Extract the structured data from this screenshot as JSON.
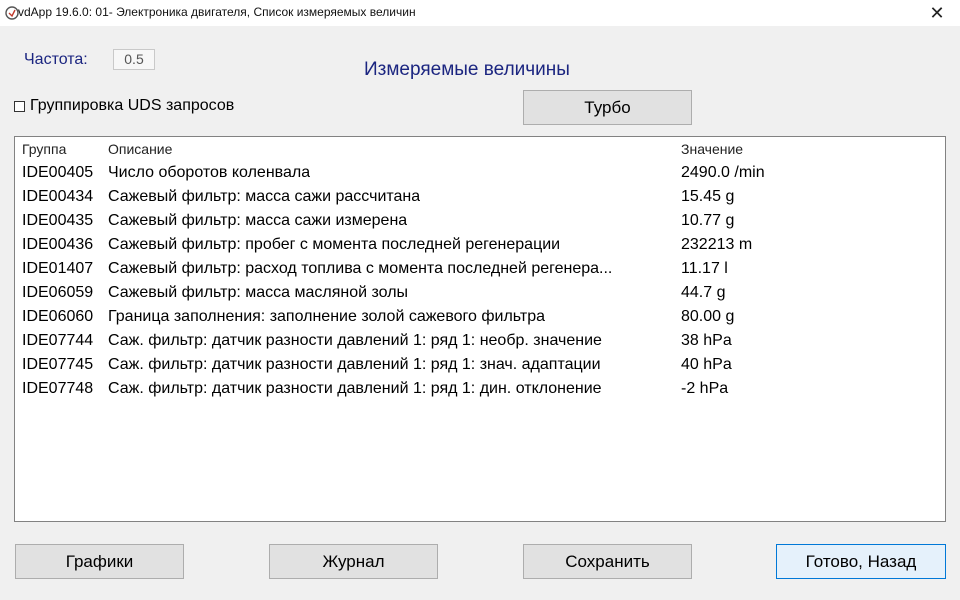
{
  "window": {
    "title": "vdApp 19.6.0: 01- Электроника двигателя,  Список измеряемых величин",
    "close_symbol": "✕"
  },
  "frequency": {
    "label": "Частота:",
    "value": "0.5"
  },
  "page_title": "Измеряемые величины",
  "uds_grouping": {
    "label": "Группировка UDS запросов",
    "checked": false
  },
  "turbo_button": "Турбо",
  "table": {
    "headers": {
      "group": "Группа",
      "description": "Описание",
      "value": "Значение"
    },
    "rows": [
      {
        "group": "IDE00405",
        "description": "Число оборотов коленвала",
        "value": "2490.0 /min"
      },
      {
        "group": "IDE00434",
        "description": "Сажевый фильтр: масса сажи рассчитана",
        "value": "15.45 g"
      },
      {
        "group": "IDE00435",
        "description": "Сажевый фильтр: масса сажи измерена",
        "value": "10.77 g"
      },
      {
        "group": "IDE00436",
        "description": "Сажевый фильтр: пробег с момента последней регенерации",
        "value": "232213 m"
      },
      {
        "group": "IDE01407",
        "description": "Сажевый фильтр: расход топлива с момента последней регенера...",
        "value": "11.17 l"
      },
      {
        "group": "IDE06059",
        "description": "Сажевый фильтр: масса масляной золы",
        "value": "44.7 g"
      },
      {
        "group": "IDE06060",
        "description": "Граница заполнения: заполнение золой сажевого фильтра",
        "value": "80.00 g"
      },
      {
        "group": "IDE07744",
        "description": "Саж. фильтр: датчик разности давлений 1: ряд 1: необр. значение",
        "value": "38 hPa"
      },
      {
        "group": "IDE07745",
        "description": "Саж. фильтр: датчик разности давлений 1: ряд 1: знач. адаптации",
        "value": "40 hPa"
      },
      {
        "group": "IDE07748",
        "description": "Саж. фильтр: датчик разности давлений 1: ряд 1: дин. отклонение",
        "value": "-2 hPa"
      }
    ]
  },
  "footer": {
    "graphs": "Графики",
    "journal": "Журнал",
    "save": "Сохранить",
    "done": "Готово, Назад"
  },
  "colors": {
    "accent_text": "#1b2580",
    "window_bg": "#f0f0f0",
    "button_bg": "#e1e1e1",
    "default_button_border": "#0078d7"
  }
}
